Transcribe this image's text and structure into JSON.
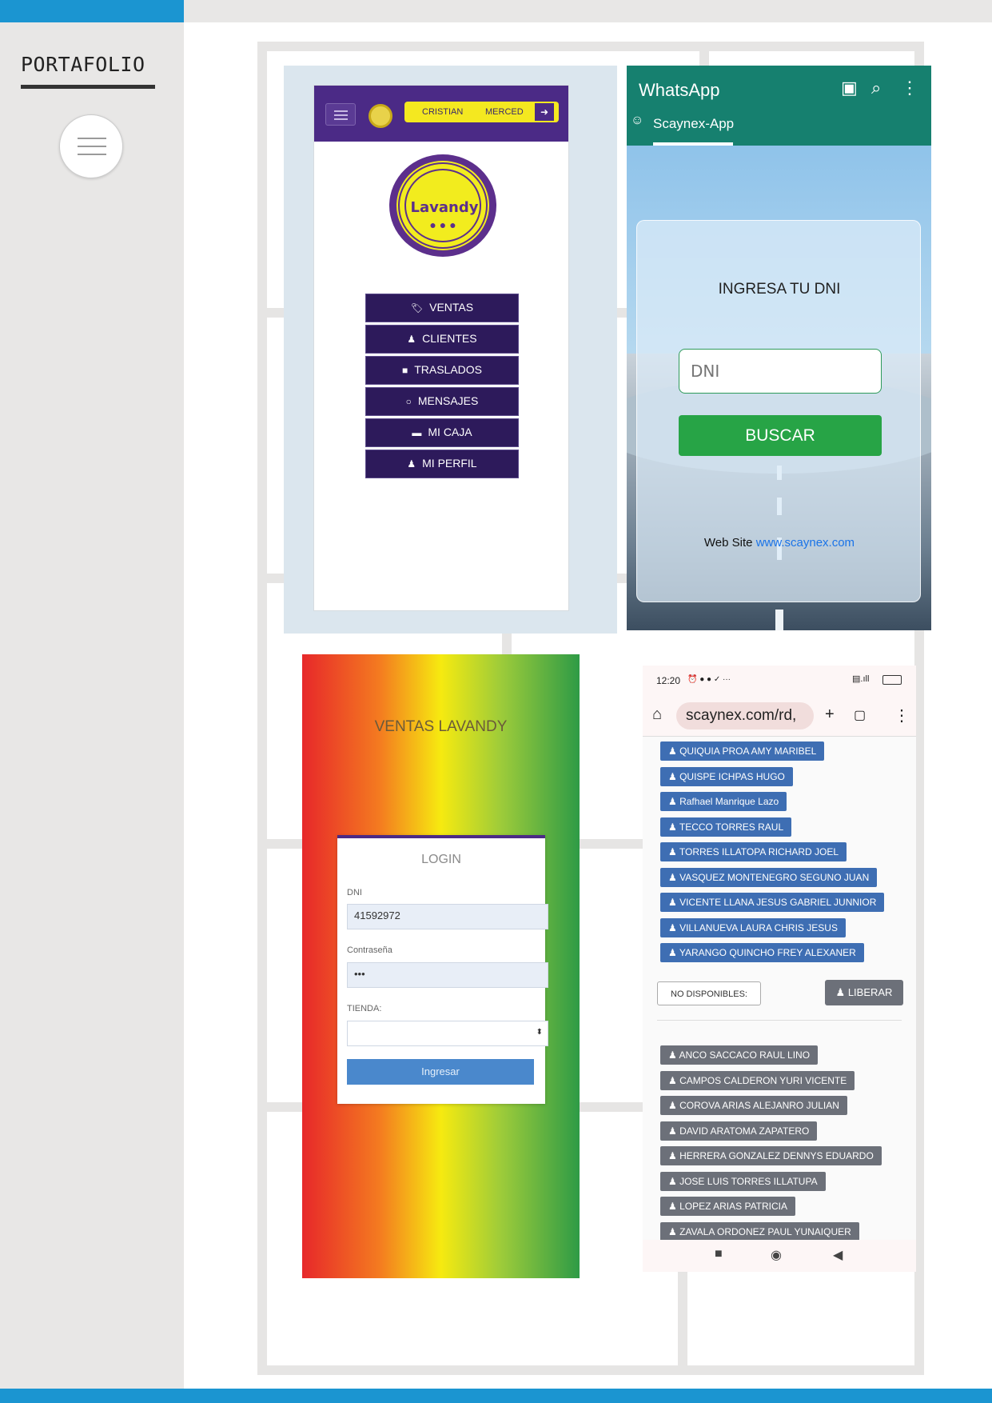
{
  "sidebar": {
    "brand": "PORTAFOLIO",
    "menu_icon": "hamburger-icon"
  },
  "lavandy_app": {
    "user_first": "CRISTIAN",
    "user_second": "MERCED",
    "logo_text": "Lavandy",
    "menu": [
      {
        "label": "VENTAS",
        "icon": "tag-icon"
      },
      {
        "label": "CLIENTES",
        "icon": "user-icon"
      },
      {
        "label": "TRASLADOS",
        "icon": "truck-icon"
      },
      {
        "label": "MENSAJES",
        "icon": "whatsapp-icon"
      },
      {
        "label": "MI CAJA",
        "icon": "cash-icon"
      },
      {
        "label": "MI PERFIL",
        "icon": "user-icon"
      }
    ]
  },
  "whatsapp_app": {
    "title": "WhatsApp",
    "tab": "Scaynex-App",
    "prompt": "INGRESA TU DNI",
    "dni_placeholder": "DNI",
    "search_button": "BUSCAR",
    "web_label": "Web Site",
    "web_link": "www.scaynex.com"
  },
  "ventas_login": {
    "title": "VENTAS LAVANDY",
    "card_title": "LOGIN",
    "dni_label": "DNI",
    "dni_value": "41592972",
    "password_label": "Contraseña",
    "password_value": "•••",
    "store_label": "TIENDA:",
    "submit": "Ingresar"
  },
  "browser_app": {
    "time": "12:20",
    "status_icons": "⏰ ● ● ✓ ···",
    "url": "scaynex.com/rd,",
    "available": [
      "QUIQUIA PROA AMY MARIBEL",
      "QUISPE ICHPAS HUGO",
      "Rafhael Manrique Lazo",
      "TECCO TORRES RAUL",
      "TORRES ILLATOPA RICHARD JOEL",
      "VASQUEZ MONTENEGRO SEGUNO JUAN",
      "VICENTE LLANA JESUS GABRIEL JUNNIOR",
      "VILLANUEVA LAURA CHRIS JESUS",
      "YARANGO QUINCHO FREY ALEXANER"
    ],
    "not_available_label": "NO DISPONIBLES:",
    "release_button": "LIBERAR",
    "unavailable": [
      "ANCO SACCACO RAUL LINO",
      "CAMPOS CALDERON YURI VICENTE",
      "COROVA ARIAS ALEJANRO JULIAN",
      "DAVID ARATOMA ZAPATERO",
      "HERRERA GONZALEZ DENNYS EDUARDO",
      "JOSE LUIS TORRES ILLATUPA",
      "LOPEZ ARIAS PATRICIA",
      "ZAVALA ORDONEZ PAUL YUNAIQUER"
    ]
  }
}
